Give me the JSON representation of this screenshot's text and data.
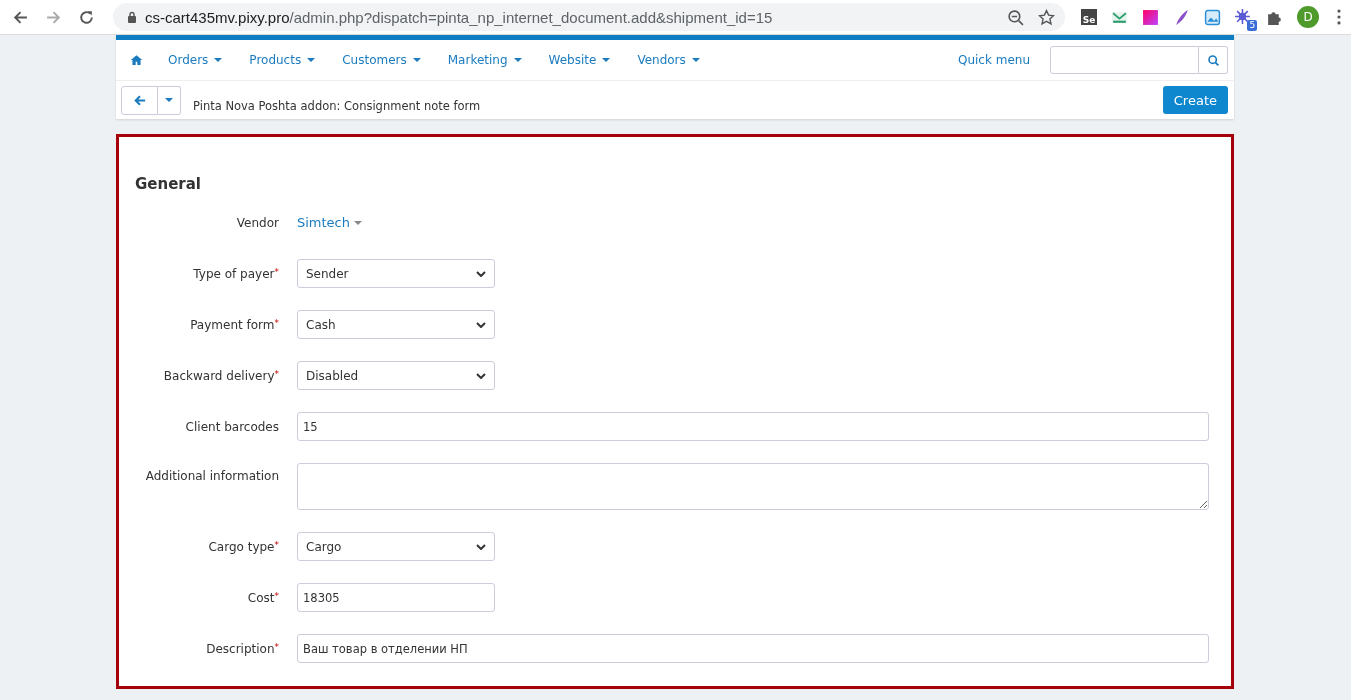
{
  "browser": {
    "url_host": "cs-cart435mv.pixy.pro",
    "url_path": "/admin.php?dispatch=pinta_np_internet_document.add&shipment_id=15",
    "extensions": [
      {
        "kind": "selenium",
        "label": "Se"
      },
      {
        "kind": "mail"
      },
      {
        "kind": "gradient"
      },
      {
        "kind": "feather"
      },
      {
        "kind": "image"
      },
      {
        "kind": "gear",
        "badge": "5"
      },
      {
        "kind": "puzzle"
      }
    ],
    "profile": "D"
  },
  "nav": {
    "items": [
      "Orders",
      "Products",
      "Customers",
      "Marketing",
      "Website",
      "Vendors"
    ],
    "quick_menu": "Quick menu"
  },
  "toolbar": {
    "title": "Pinta Nova Poshta addon: Consignment note form",
    "create": "Create"
  },
  "form": {
    "section": "General",
    "highlighted": true,
    "fields": [
      {
        "label": "Vendor",
        "kind": "link",
        "value": "Simtech"
      },
      {
        "label": "Type of payer",
        "kind": "select",
        "required_mark": "*",
        "value": "Sender"
      },
      {
        "label": "Payment form",
        "kind": "select",
        "required_mark": "*",
        "value": "Cash"
      },
      {
        "label": "Backward delivery",
        "kind": "select",
        "required_mark": "*",
        "value": "Disabled"
      },
      {
        "label": "Client barcodes",
        "kind": "input",
        "value": "15"
      },
      {
        "label": "Additional information",
        "kind": "textarea"
      },
      {
        "label": "Cargo type",
        "kind": "select",
        "required_mark": "*",
        "value": "Cargo"
      },
      {
        "label": "Cost",
        "kind": "short",
        "required_mark": "*",
        "value": "18305"
      },
      {
        "label": "Description",
        "kind": "input",
        "required_mark": "*",
        "value": "Ваш товар в отделении НП"
      }
    ]
  }
}
